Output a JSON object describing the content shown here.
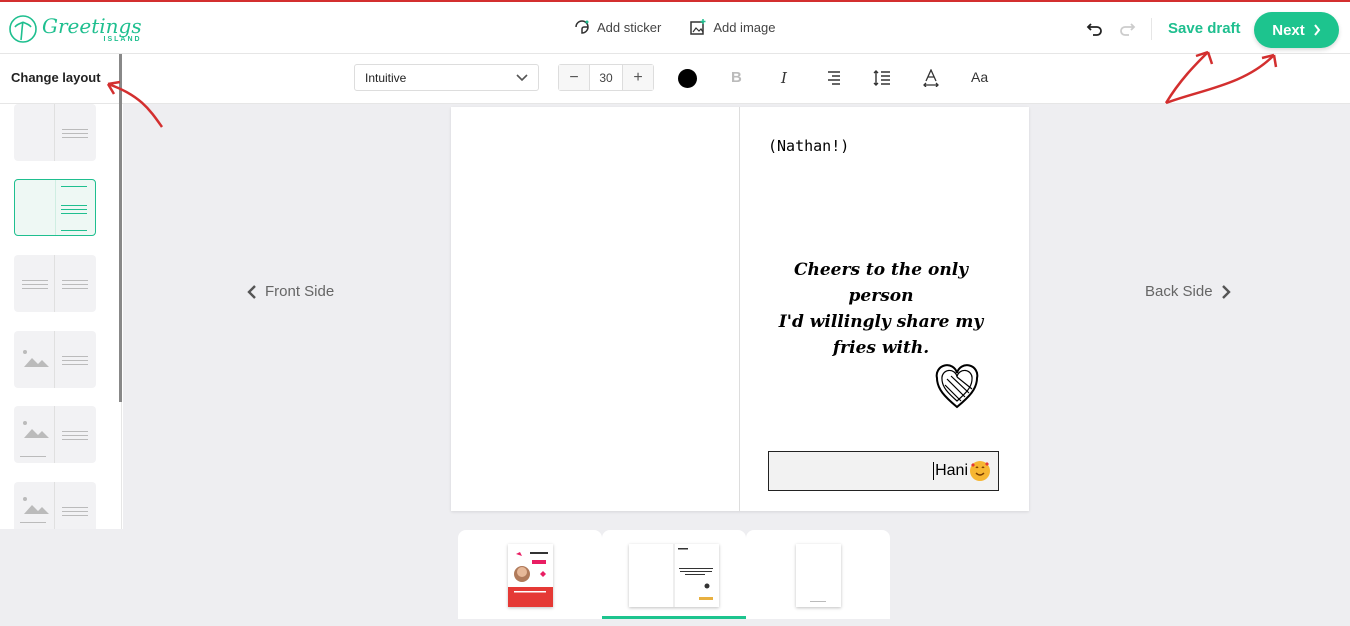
{
  "header": {
    "logo_main": "Greetings",
    "logo_sub": "ISLAND",
    "add_sticker": "Add sticker",
    "add_image": "Add image",
    "save_draft": "Save draft",
    "next": "Next"
  },
  "toolbar": {
    "change_layout": "Change layout",
    "font": "Intuitive",
    "size": "30",
    "minus": "−",
    "plus": "+",
    "bold": "B",
    "italic": "I",
    "case": "Aa",
    "text_color": "#000000"
  },
  "nav": {
    "front": "Front Side",
    "back": "Back Side"
  },
  "card": {
    "name": "(Nathan!)",
    "message_lines": [
      "Cheers to the only person",
      "I'd willingly share my",
      "fries with."
    ],
    "signature": "Hani"
  },
  "colors": {
    "accent": "#1dc48e",
    "annotation": "#d32f2f"
  }
}
